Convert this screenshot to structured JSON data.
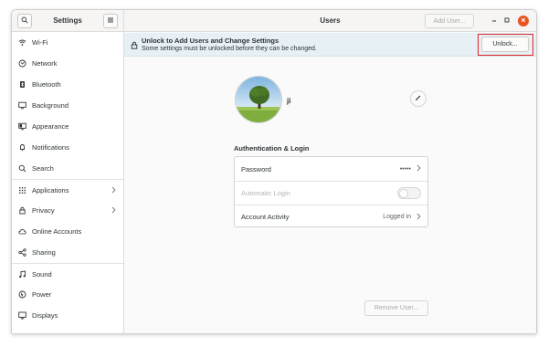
{
  "sidebar": {
    "title": "Settings",
    "items": [
      {
        "label": "Wi-Fi",
        "icon": "wifi-icon"
      },
      {
        "label": "Network",
        "icon": "network-icon"
      },
      {
        "label": "Bluetooth",
        "icon": "bluetooth-icon"
      },
      {
        "label": "Background",
        "icon": "background-icon"
      },
      {
        "label": "Appearance",
        "icon": "appearance-icon"
      },
      {
        "label": "Notifications",
        "icon": "bell-icon"
      },
      {
        "label": "Search",
        "icon": "search-icon"
      },
      {
        "label": "Applications",
        "icon": "grid-icon"
      },
      {
        "label": "Privacy",
        "icon": "lock-icon"
      },
      {
        "label": "Online Accounts",
        "icon": "cloud-icon"
      },
      {
        "label": "Sharing",
        "icon": "share-icon"
      },
      {
        "label": "Sound",
        "icon": "music-note-icon"
      },
      {
        "label": "Power",
        "icon": "power-icon"
      },
      {
        "label": "Displays",
        "icon": "display-icon"
      }
    ]
  },
  "header": {
    "title": "Users",
    "add_user_label": "Add User..."
  },
  "infobar": {
    "title": "Unlock to Add Users and Change Settings",
    "subtitle": "Some settings must be unlocked before they can be changed.",
    "unlock_label": "Unlock..."
  },
  "user": {
    "name": "ji"
  },
  "auth": {
    "section_title": "Authentication & Login",
    "rows": [
      {
        "label": "Password",
        "value": "•••••"
      },
      {
        "label": "Automatic Login",
        "enabled": false
      },
      {
        "label": "Account Activity",
        "value": "Logged in"
      }
    ]
  },
  "footer": {
    "remove_user_label": "Remove User..."
  },
  "colors": {
    "accent": "#e95420",
    "infobar_bg": "#e6f0f5",
    "highlight_box": "#e0262d"
  }
}
